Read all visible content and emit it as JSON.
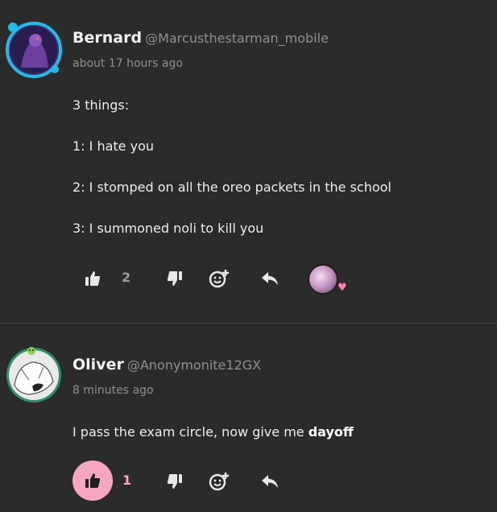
{
  "comments": [
    {
      "username": "Bernard",
      "handle": "@Marcusthestarman_mobile",
      "timestamp": "about 17 hours ago",
      "lines": [
        "3 things:",
        "1: I hate you",
        "2: I stomped on all the oreo packets in the school",
        "3: I summoned noli to kill you"
      ],
      "likes": "2",
      "liked": false
    },
    {
      "username": "Oliver",
      "handle": "@Anonymonite12GX",
      "timestamp": "8 minutes ago",
      "text_before_bold": "I pass the exam circle, now give me ",
      "text_bold": "dayoff",
      "likes": "1",
      "liked": true
    }
  ],
  "icons": {
    "like": "thumbs-up-icon",
    "dislike": "thumbs-down-icon",
    "react": "add-emoji-icon",
    "reply": "reply-icon",
    "reaction_heart": "♥"
  },
  "colors": {
    "background": "#2b2b2b",
    "accent_pink": "#f6a6c1",
    "muted_text": "#8e8e8e"
  }
}
